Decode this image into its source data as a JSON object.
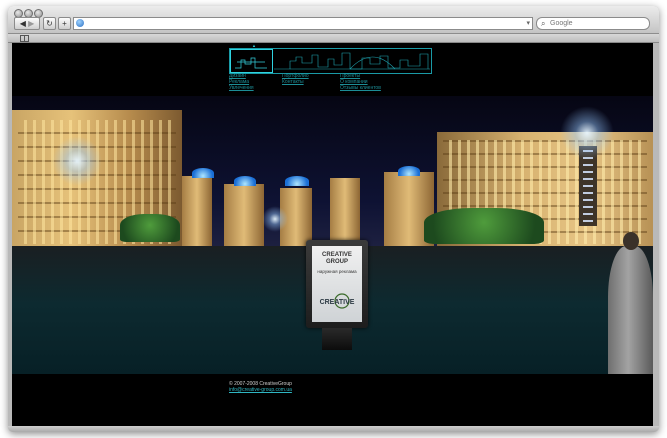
{
  "browser": {
    "url": "",
    "search_placeholder": "Google"
  },
  "site": {
    "menu": {
      "col1": [
        "Дизайн",
        "Реклама",
        "Увлечения"
      ],
      "col2": [
        "Портфолио",
        "Контакты"
      ],
      "col3": [
        "Проекты",
        "О компании",
        "Отзывы клиентов"
      ]
    },
    "billboard": {
      "title": "CREATIVE GROUP",
      "subtitle": "наружная реклама",
      "logo_text": "CREATIVE"
    },
    "footer": {
      "copyright": "© 2007-2008 CreativeGroup",
      "email": "info@creative-group.com.ua"
    }
  },
  "colors": {
    "accent": "#2fb6c2",
    "background": "#000000"
  },
  "icons": {
    "back": "chevron-left-icon",
    "forward": "chevron-right-icon",
    "reload": "reload-icon",
    "add": "plus-icon",
    "search": "search-icon",
    "bookmarks": "book-icon"
  }
}
